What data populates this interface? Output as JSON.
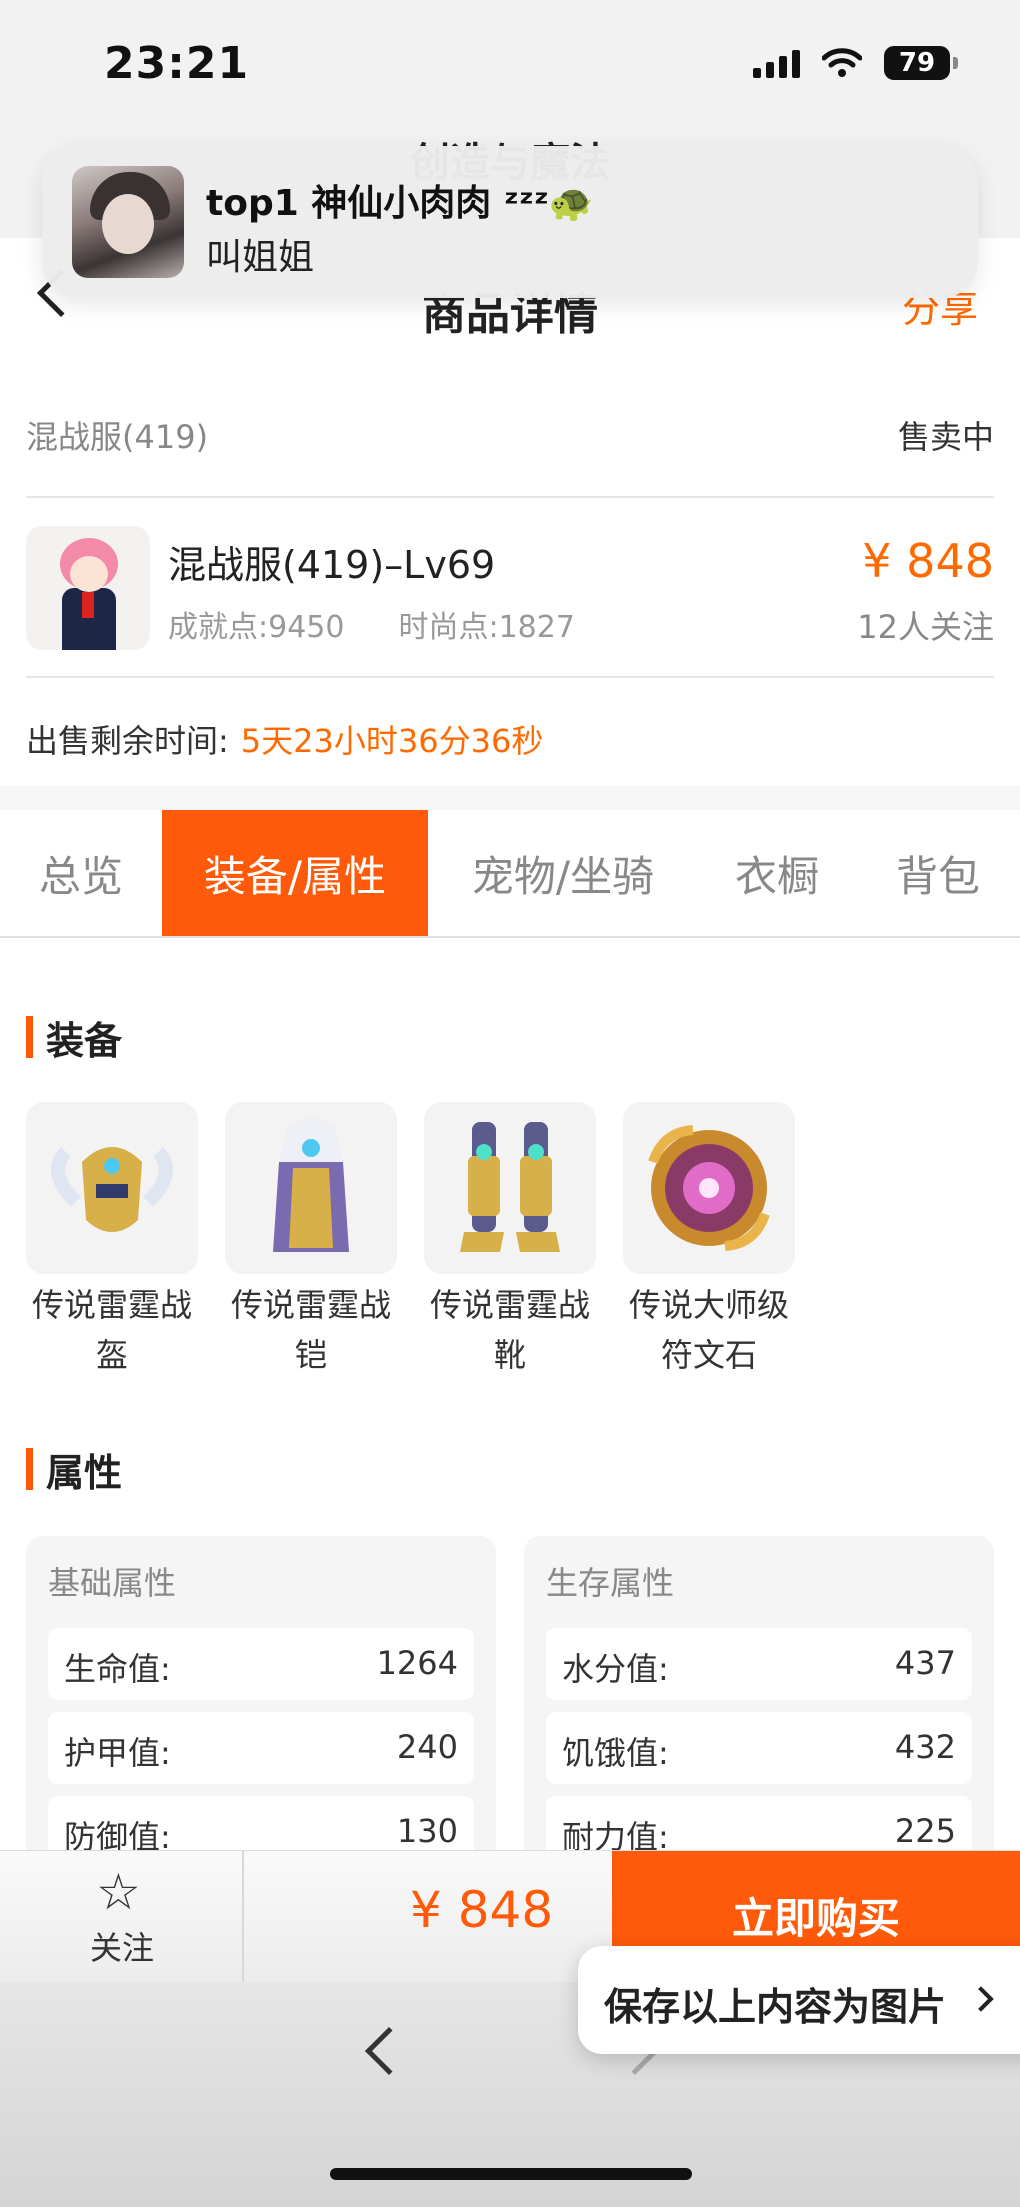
{
  "status_bar": {
    "time": "23:21",
    "battery": "79"
  },
  "notification": {
    "title": "top1 神仙小肉肉 ᶻᶻᶻ🐢",
    "message": "叫姐姐"
  },
  "header": {
    "partial_title": "创造与魔法",
    "title": "商品详情",
    "share": "分享"
  },
  "listing": {
    "server": "混战服(419)",
    "status": "售卖中",
    "product_name": "混战服(419)–Lv69",
    "achievement": "成就点:9450",
    "fashion": "时尚点:1827",
    "price": "¥ 848",
    "followers": "12人关注",
    "remaining_label": "出售剩余时间:",
    "remaining_value": "5天23小时36分36秒"
  },
  "tabs": [
    "总览",
    "装备/属性",
    "宠物/坐骑",
    "衣橱",
    "背包"
  ],
  "active_tab": "装备/属性",
  "equipment": {
    "heading": "装备",
    "items": [
      {
        "name": "传说雷霆战盔"
      },
      {
        "name": "传说雷霆战铠"
      },
      {
        "name": "传说雷霆战靴"
      },
      {
        "name": "传说大师级符文石"
      }
    ]
  },
  "attributes": {
    "heading": "属性",
    "base": {
      "title": "基础属性",
      "rows": [
        {
          "k": "生命值:",
          "v": "1264"
        },
        {
          "k": "护甲值:",
          "v": "240"
        },
        {
          "k": "防御值:",
          "v": "130"
        }
      ]
    },
    "survival": {
      "title": "生存属性",
      "rows": [
        {
          "k": "水分值:",
          "v": "437"
        },
        {
          "k": "饥饿值:",
          "v": "432"
        },
        {
          "k": "耐力值:",
          "v": "225"
        }
      ]
    }
  },
  "bottom_bar": {
    "follow": "关注",
    "price": "¥ 848",
    "buy": "立即购买"
  },
  "save_popup": "保存以上内容为图片",
  "colors": {
    "accent": "#ff5a0a",
    "price": "#ff6a00"
  }
}
